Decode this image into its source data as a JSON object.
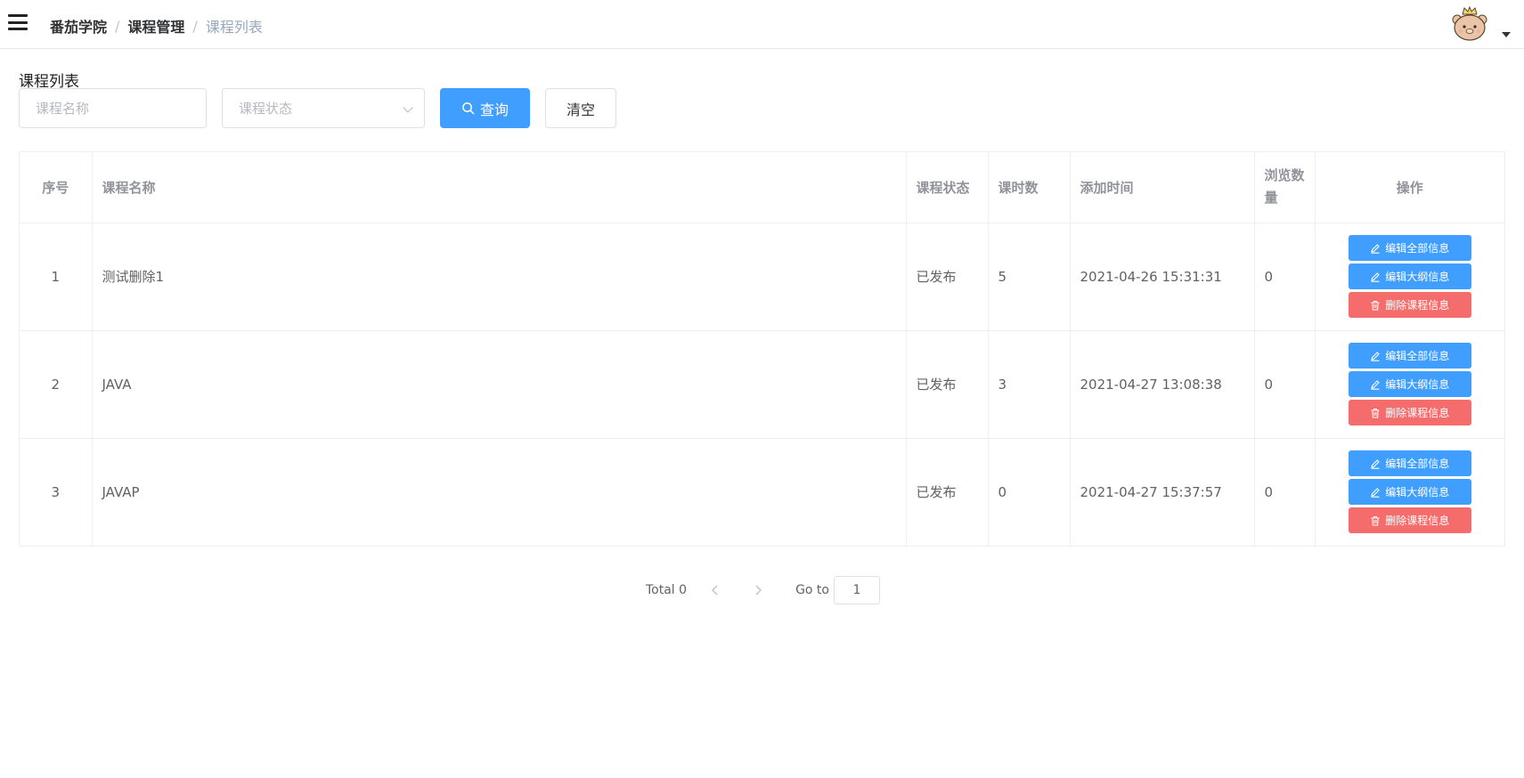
{
  "navbar": {
    "breadcrumb": [
      "番茄学院",
      "课程管理",
      "课程列表"
    ]
  },
  "page": {
    "title": "课程列表"
  },
  "search": {
    "name_placeholder": "课程名称",
    "status_placeholder": "课程状态",
    "query_label": "查询",
    "clear_label": "清空"
  },
  "table": {
    "columns": [
      "序号",
      "课程名称",
      "课程状态",
      "课时数",
      "添加时间",
      "浏览数量",
      "操作"
    ],
    "rows": [
      {
        "index": "1",
        "name": "测试删除1",
        "status": "已发布",
        "lessons": "5",
        "added": "2021-04-26 15:31:31",
        "views": "0"
      },
      {
        "index": "2",
        "name": "JAVA",
        "status": "已发布",
        "lessons": "3",
        "added": "2021-04-27 13:08:38",
        "views": "0"
      },
      {
        "index": "3",
        "name": "JAVAP",
        "status": "已发布",
        "lessons": "0",
        "added": "2021-04-27 15:37:57",
        "views": "0"
      }
    ],
    "actions": {
      "edit_all": "编辑全部信息",
      "edit_outline": "编辑大纲信息",
      "delete": "删除课程信息"
    }
  },
  "pagination": {
    "total": "Total 0",
    "goto_label": "Go to",
    "current_page": "1"
  },
  "colors": {
    "primary": "#409eff",
    "danger": "#f56c6c"
  }
}
